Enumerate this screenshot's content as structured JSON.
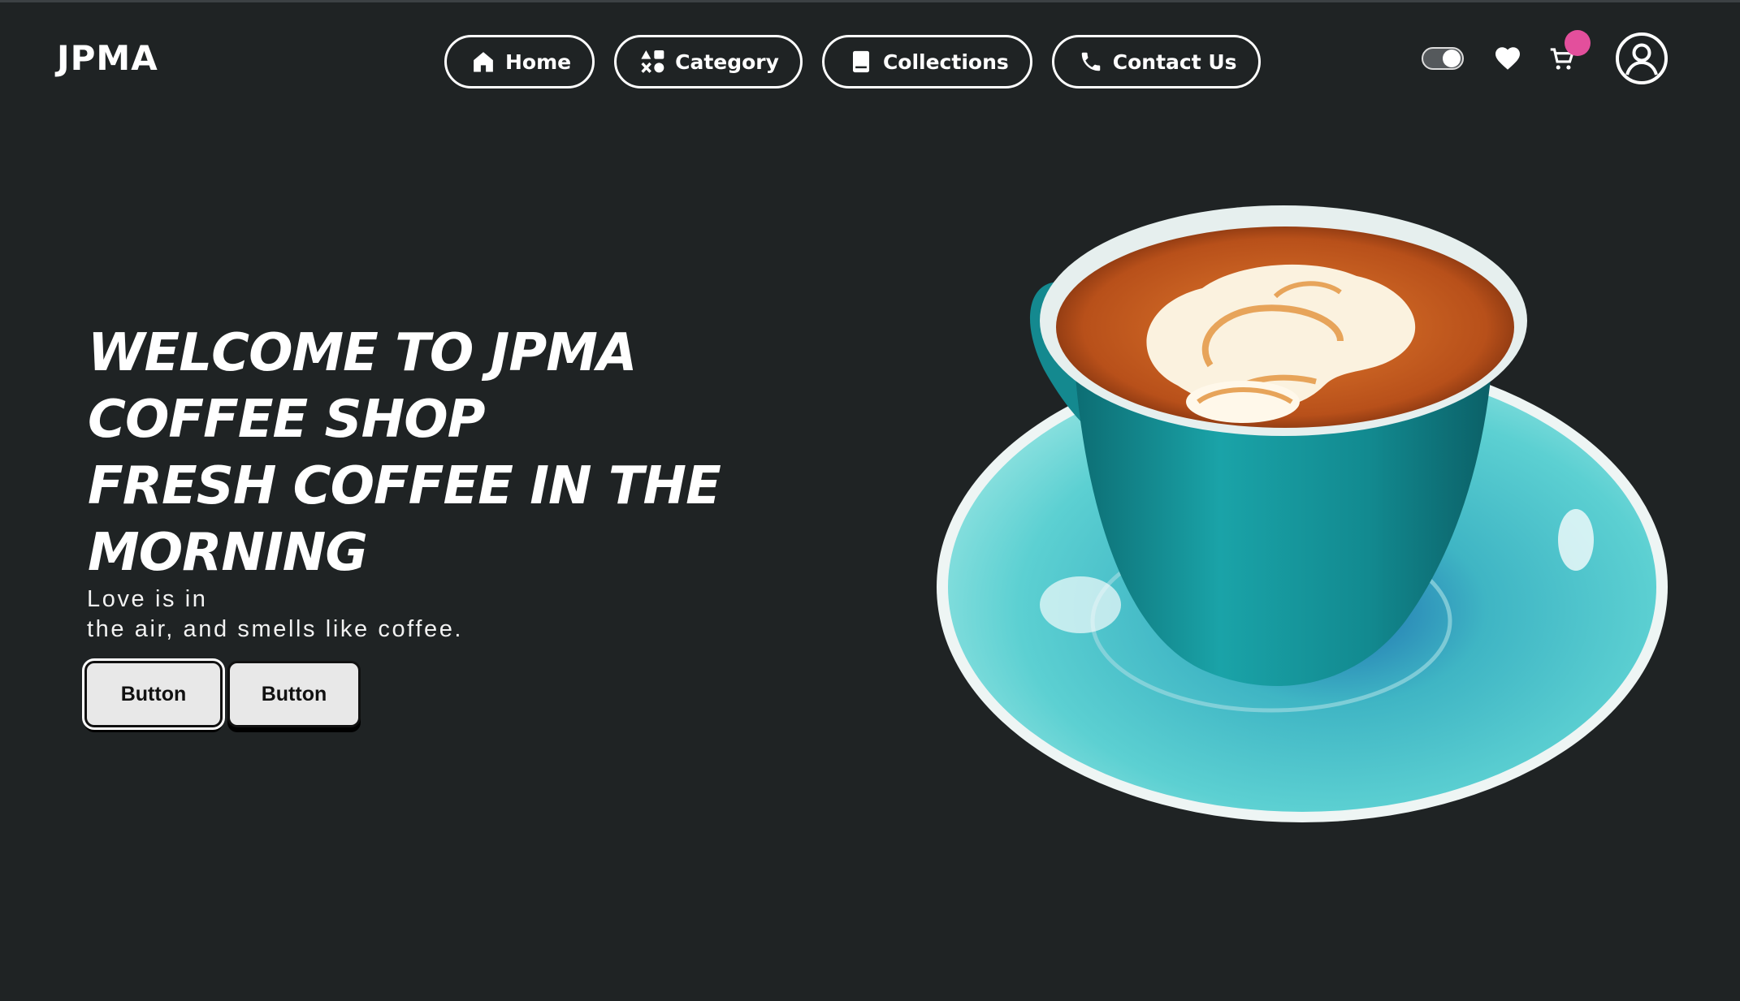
{
  "header": {
    "logo": "JPMA",
    "nav": [
      {
        "label": "Home",
        "icon": "home-icon"
      },
      {
        "label": "Category",
        "icon": "category-icon"
      },
      {
        "label": "Collections",
        "icon": "book-icon"
      },
      {
        "label": "Contact Us",
        "icon": "phone-icon"
      }
    ],
    "toolbar": {
      "theme_toggle": "toggle-switch-icon",
      "wishlist": "heart-icon",
      "cart": "cart-icon",
      "cart_badge_color": "#e34f9c",
      "account": "user-circle-icon"
    }
  },
  "hero": {
    "title_lines": [
      "WELCOME TO JPMA",
      "COFFEE SHOP",
      "FRESH COFFEE IN THE",
      "MORNING"
    ],
    "tagline_lines": [
      "Love is in",
      "the air, and smells like coffee."
    ],
    "buttons": [
      "Button",
      "Button"
    ],
    "image": "latte-cup-on-saucer"
  },
  "colors": {
    "background": "#1f2324",
    "text": "#ffffff",
    "button_bg": "#e8e8e8",
    "cup_teal": "#1b9aa0",
    "saucer_teal": "#55c8cc"
  }
}
